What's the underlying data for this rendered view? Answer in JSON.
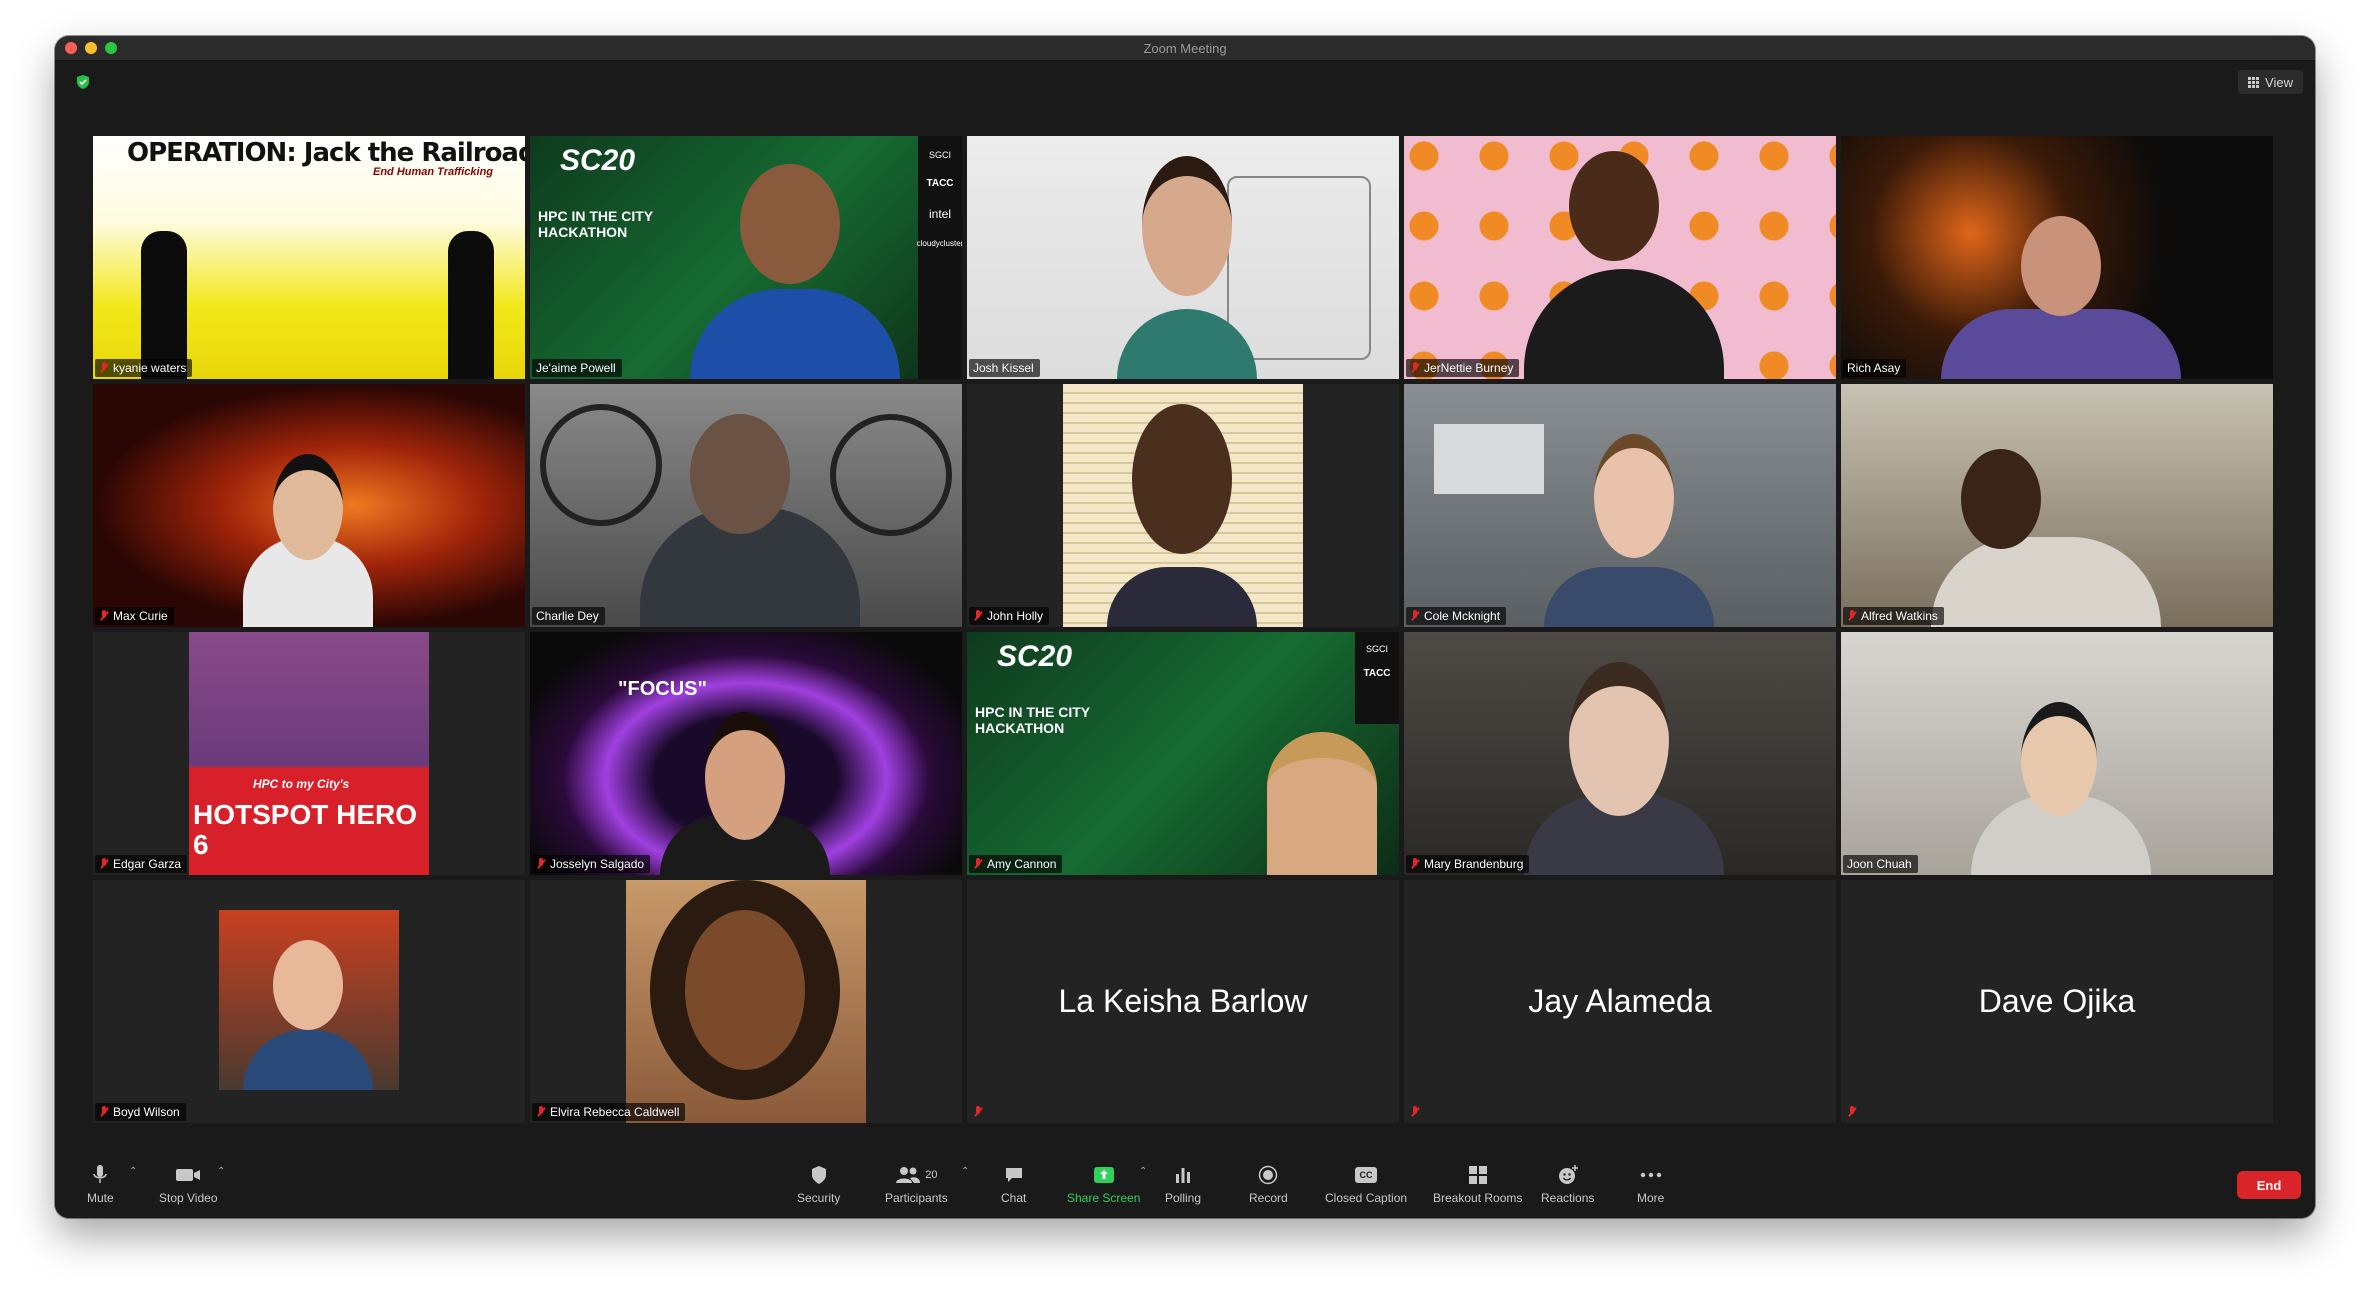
{
  "window": {
    "title": "Zoom Meeting",
    "view_label": "View"
  },
  "tiles": [
    {
      "name": "kyanie waters",
      "overlay_title": "OPERATION: Jack the Railroad",
      "overlay_sub": "End Human Trafficking"
    },
    {
      "name": "Je'aime Powell",
      "overlay_title": "SC20",
      "overlay_sub": "HPC IN THE CITY HACKATHON",
      "side_logos": [
        "SGCI",
        "TACC",
        "intel",
        "cloudycluster"
      ]
    },
    {
      "name": "Josh Kissel"
    },
    {
      "name": "JerNettie Burney"
    },
    {
      "name": "Rich Asay",
      "active": true
    },
    {
      "name": "Max Curie"
    },
    {
      "name": "Charlie Dey"
    },
    {
      "name": "John Holly"
    },
    {
      "name": "Cole Mcknight"
    },
    {
      "name": "Alfred Watkins"
    },
    {
      "name": "Edgar Garza",
      "overlay_title": "HOTSPOT HERO 6",
      "overlay_sub": "HPC to my City's"
    },
    {
      "name": "Josselyn Salgado",
      "overlay_title": "\"FOCUS\""
    },
    {
      "name": "Amy Cannon",
      "overlay_title": "SC20",
      "overlay_sub": "HPC IN THE CITY HACKATHON",
      "side_logos": [
        "SGCI",
        "TACC"
      ]
    },
    {
      "name": "Mary Brandenburg"
    },
    {
      "name": "Joon Chuah"
    },
    {
      "name": "Boyd Wilson"
    },
    {
      "name": "Elvira Rebecca Caldwell"
    },
    {
      "name": "La Keisha Barlow",
      "video_off": true
    },
    {
      "name": "Jay Alameda",
      "video_off": true
    },
    {
      "name": "Dave Ojika",
      "video_off": true
    }
  ],
  "toolbar": {
    "mute": "Mute",
    "stop_video": "Stop Video",
    "security": "Security",
    "participants": "Participants",
    "participants_count": "20",
    "chat": "Chat",
    "share_screen": "Share Screen",
    "polling": "Polling",
    "record": "Record",
    "closed_caption": "Closed Caption",
    "closed_caption_icon": "CC",
    "breakout_rooms": "Breakout Rooms",
    "reactions": "Reactions",
    "more": "More",
    "end": "End"
  },
  "colors": {
    "accent_green": "#2fd15a",
    "end_red": "#d9252a",
    "active_speaker": "#d7e36a"
  }
}
